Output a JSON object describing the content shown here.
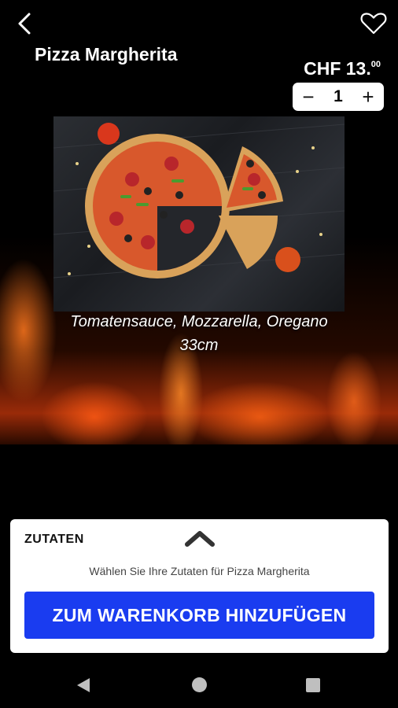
{
  "header": {
    "back_icon": "chevron-left-icon",
    "favorite_icon": "heart-outline-icon"
  },
  "product": {
    "name": "Pizza Margherita",
    "price_main": "CHF 13.",
    "price_cents": "00",
    "quantity": "1",
    "qty_minus": "−",
    "qty_plus": "+",
    "description_line1": "Tomatensauce, Mozzarella, Oregano",
    "description_line2": "33cm"
  },
  "ingredients_panel": {
    "label": "ZUTATEN",
    "toggle_icon": "chevron-up-icon",
    "hint": "Wählen Sie Ihre Zutaten für Pizza Margherita",
    "add_to_cart_label": "ZUM WARENKORB HINZUFÜGEN"
  },
  "colors": {
    "background": "#000000",
    "primary_button": "#1a3cf0",
    "panel": "#ffffff"
  },
  "system_nav": {
    "back_icon": "triangle-back-icon",
    "home_icon": "circle-home-icon",
    "recents_icon": "square-recents-icon"
  }
}
